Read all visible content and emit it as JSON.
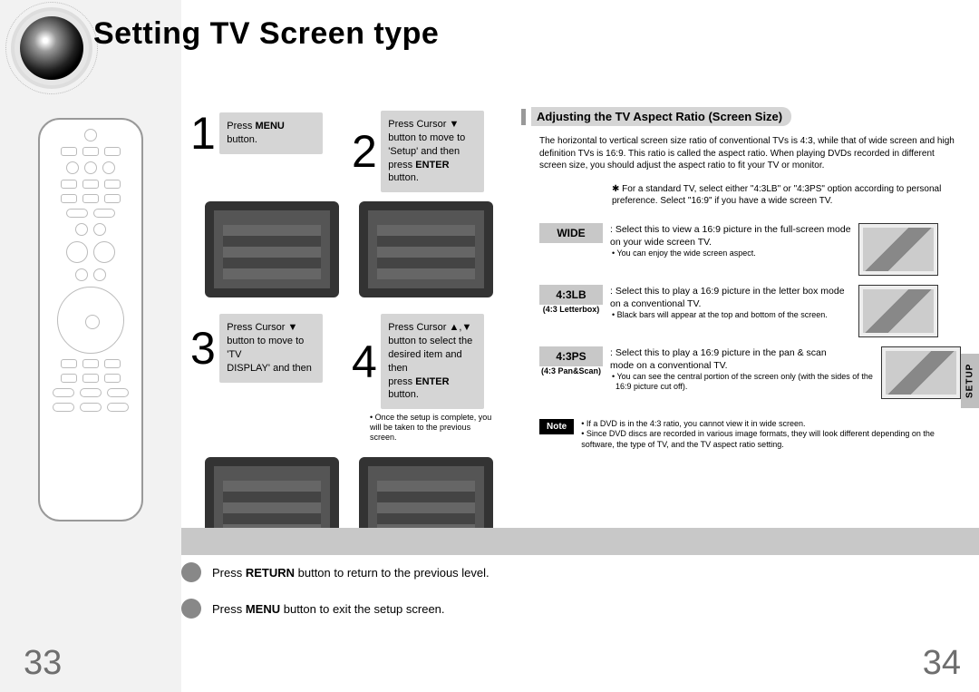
{
  "title": "Setting TV Screen type",
  "steps": {
    "s1": {
      "num": "1",
      "text_pre": "Press ",
      "bold": "MENU",
      "text_post": " button."
    },
    "s2": {
      "num": "2",
      "line1": "Press Cursor ▼",
      "line2": "button to move to",
      "line3": "'Setup' and then",
      "line4_pre": "press ",
      "line4_bold": "ENTER",
      "line4_post": " button."
    },
    "s3": {
      "num": "3",
      "line1": "Press Cursor ▼",
      "line2": "button to move to 'TV",
      "line3": "DISPLAY' and then"
    },
    "s4": {
      "num": "4",
      "line1": "Press Cursor ▲,▼",
      "line2": "button to select the",
      "line3": "desired item and then",
      "line4_pre": "press ",
      "line4_bold": "ENTER",
      "line4_post": " button."
    },
    "note34": "• Once the setup is complete, you will be taken to the previous screen."
  },
  "right": {
    "section_title": "Adjusting the TV Aspect Ratio (Screen Size)",
    "intro": "The horizontal to vertical screen size ratio of conventional TVs is 4:3, while that of wide screen and high definition TVs is 16:9. This ratio is called the aspect ratio. When playing DVDs recorded in different screen size, you should adjust the aspect ratio to fit your TV or monitor.",
    "star": "✱ For a standard TV, select either \"4:3LB\" or \"4:3PS\" option according to personal preference. Select \"16:9\" if you have a wide screen TV.",
    "opts": {
      "wide": {
        "label": "WIDE",
        "text": ": Select this to view a 16:9 picture in the full-screen mode on your wide screen TV.",
        "bullet": "• You can enjoy the wide screen aspect."
      },
      "lb": {
        "label": "4:3LB",
        "sub": "(4:3 Letterbox)",
        "text": ": Select this to play a 16:9 picture in the letter box mode on a conventional TV.",
        "bullet": "• Black bars will appear at the top and bottom of the screen."
      },
      "ps": {
        "label": "4:3PS",
        "sub": "(4:3 Pan&Scan)",
        "text": ": Select this to play a 16:9 picture in the pan & scan mode on a conventional TV.",
        "bullet": "• You can see the central portion of the screen only (with the sides of the 16:9 picture cut off)."
      }
    },
    "note_label": "Note",
    "note_text": "• If a DVD is in the 4:3 ratio, you cannot view it in wide screen.\n• Since DVD discs are recorded in various image formats, they will look different depending on the software, the type of TV, and the TV aspect ratio setting."
  },
  "bottom": {
    "line1_pre": "Press ",
    "line1_bold": "RETURN",
    "line1_post": " button to return to the previous level.",
    "line2_pre": "Press ",
    "line2_bold": "MENU",
    "line2_post": " button to exit the setup screen."
  },
  "pagenums": {
    "left": "33",
    "right": "34"
  },
  "tab": "SETUP"
}
